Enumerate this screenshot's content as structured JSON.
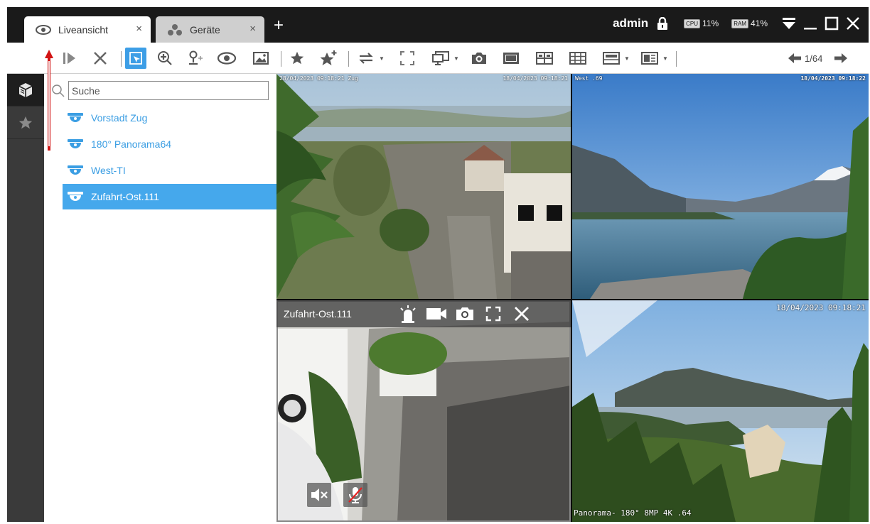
{
  "tabs": [
    {
      "label": "Liveansicht",
      "close": "×",
      "icon": "eye-icon"
    },
    {
      "label": "Geräte",
      "close": "×",
      "icon": "devices-icon"
    }
  ],
  "tab_add": "+",
  "user": {
    "name": "admin",
    "cpu_label": "CPU",
    "cpu_value": "11%",
    "ram_label": "RAM",
    "ram_value": "41%"
  },
  "toolbar": {
    "page_indicator": "1/64"
  },
  "search": {
    "placeholder": "Suche"
  },
  "devices": [
    {
      "label": "Vorstadt Zug"
    },
    {
      "label": "180° Panorama64"
    },
    {
      "label": "West-TI"
    },
    {
      "label": "Zufahrt-Ost.111"
    }
  ],
  "tiles": [
    {
      "osd_left": "28/04/2023 09:18:21 Zug",
      "osd_right": "18/04/2023 09:18:21"
    },
    {
      "osd_left": "West .69",
      "osd_right": "18/04/2023 09:18:22"
    },
    {
      "overlay_name": "Zufahrt-Ost.111"
    },
    {
      "osd_right": "18/04/2023 09:18:21",
      "osd_bottom": "Panorama- 180° 8MP 4K .64"
    }
  ],
  "colors": {
    "accent": "#3d9ee6",
    "selected_row": "#45a8ec",
    "device_text": "#3b9ee3",
    "annotation": "#d21414"
  }
}
